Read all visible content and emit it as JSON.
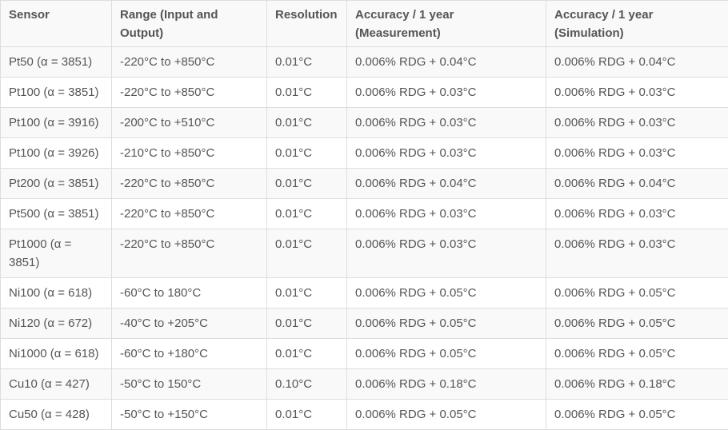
{
  "table": {
    "headers": [
      "Sensor",
      "Range (Input and Output)",
      "Resolution",
      "Accuracy / 1 year (Measurement)",
      "Accuracy / 1 year (Simulation)"
    ],
    "rows": [
      [
        "Pt50 (α = 3851)",
        "-220°C to +850°C",
        "0.01°C",
        "0.006% RDG + 0.04°C",
        "0.006% RDG + 0.04°C"
      ],
      [
        "Pt100 (α = 3851)",
        "-220°C to +850°C",
        "0.01°C",
        "0.006% RDG + 0.03°C",
        "0.006% RDG + 0.03°C"
      ],
      [
        "Pt100 (α = 3916)",
        "-200°C to +510°C",
        "0.01°C",
        "0.006% RDG + 0.03°C",
        "0.006% RDG + 0.03°C"
      ],
      [
        "Pt100 (α = 3926)",
        "-210°C to +850°C",
        "0.01°C",
        "0.006% RDG + 0.03°C",
        "0.006% RDG + 0.03°C"
      ],
      [
        "Pt200 (α = 3851)",
        "-220°C to +850°C",
        "0.01°C",
        "0.006% RDG + 0.04°C",
        "0.006% RDG + 0.04°C"
      ],
      [
        "Pt500 (α = 3851)",
        "-220°C to +850°C",
        "0.01°C",
        "0.006% RDG + 0.03°C",
        "0.006% RDG + 0.03°C"
      ],
      [
        "Pt1000 (α = 3851)",
        "-220°C to +850°C",
        "0.01°C",
        "0.006% RDG + 0.03°C",
        "0.006% RDG + 0.03°C"
      ],
      [
        "Ni100 (α = 618)",
        "-60°C to 180°C",
        "0.01°C",
        "0.006% RDG + 0.05°C",
        "0.006% RDG + 0.05°C"
      ],
      [
        "Ni120 (α = 672)",
        "-40°C to +205°C",
        "0.01°C",
        "0.006% RDG + 0.05°C",
        "0.006% RDG + 0.05°C"
      ],
      [
        "Ni1000 (α = 618)",
        "-60°C to +180°C",
        "0.01°C",
        "0.006% RDG + 0.05°C",
        "0.006% RDG + 0.05°C"
      ],
      [
        "Cu10 (α = 427)",
        "-50°C to 150°C",
        "0.10°C",
        "0.006% RDG + 0.18°C",
        "0.006% RDG + 0.18°C"
      ],
      [
        "Cu50 (α = 428)",
        "-50°C to +150°C",
        "0.01°C",
        "0.006% RDG + 0.05°C",
        "0.006% RDG + 0.05°C"
      ]
    ]
  }
}
